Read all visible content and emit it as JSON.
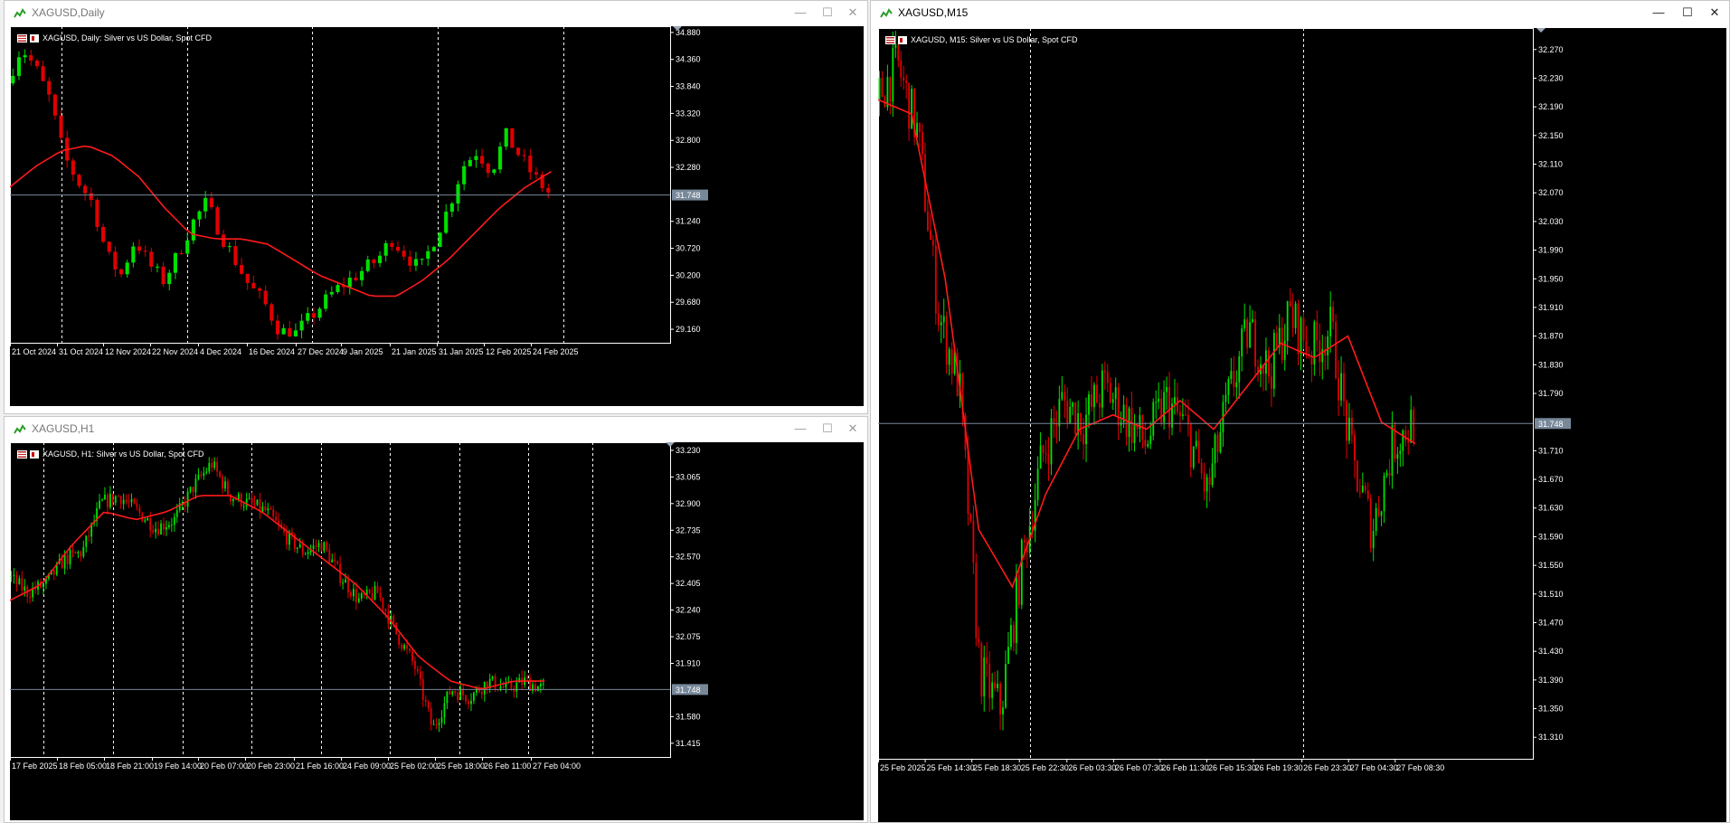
{
  "colors": {
    "bull": "#00e000",
    "bear": "#e00000",
    "ma": "#ff1a1a",
    "price_line": "#778899",
    "grid": "#ffffff"
  },
  "windows": [
    {
      "title": "XAGUSD,Daily",
      "legend": "XAGUSD, Daily:  Silver vs US Dollar, Spot CFD",
      "price_label": "31.748",
      "y_labels": [
        "34.880",
        "34.360",
        "33.840",
        "33.320",
        "32.800",
        "32.280",
        "31.240",
        "30.720",
        "30.200",
        "29.680",
        "29.160"
      ],
      "x_labels": [
        "21 Oct 2024",
        "31 Oct 2024",
        "12 Nov 2024",
        "22 Nov 2024",
        "4 Dec 2024",
        "16 Dec 2024",
        "27 Dec 2024",
        "9 Jan 2025",
        "21 Jan 2025",
        "31 Jan 2025",
        "12 Feb 2025",
        "24 Feb 2025"
      ]
    },
    {
      "title": "XAGUSD,H1",
      "legend": "XAGUSD, H1:  Silver vs US Dollar, Spot CFD",
      "price_label": "31.748",
      "y_labels": [
        "33.230",
        "33.065",
        "32.900",
        "32.735",
        "32.570",
        "32.405",
        "32.240",
        "32.075",
        "31.910",
        "31.580",
        "31.415"
      ],
      "x_labels": [
        "17 Feb 2025",
        "18 Feb 05:00",
        "18 Feb 21:00",
        "19 Feb 14:00",
        "20 Feb 07:00",
        "20 Feb 23:00",
        "21 Feb 16:00",
        "24 Feb 09:00",
        "25 Feb 02:00",
        "25 Feb 18:00",
        "26 Feb 11:00",
        "27 Feb 04:00"
      ]
    },
    {
      "title": "XAGUSD,M15",
      "legend": "XAGUSD, M15:  Silver vs US Dollar, Spot CFD",
      "price_label": "31.748",
      "y_labels": [
        "32.270",
        "32.230",
        "32.190",
        "32.150",
        "32.110",
        "32.070",
        "32.030",
        "31.990",
        "31.950",
        "31.910",
        "31.870",
        "31.830",
        "31.790",
        "31.710",
        "31.670",
        "31.630",
        "31.590",
        "31.550",
        "31.510",
        "31.470",
        "31.430",
        "31.390",
        "31.350",
        "31.310"
      ],
      "x_labels": [
        "25 Feb 2025",
        "25 Feb 14:30",
        "25 Feb 18:30",
        "25 Feb 22:30",
        "26 Feb 03:30",
        "26 Feb 07:30",
        "26 Feb 11:30",
        "26 Feb 15:30",
        "26 Feb 19:30",
        "26 Feb 23:30",
        "27 Feb 04:30",
        "27 Feb 08:30"
      ]
    }
  ],
  "chart_data": [
    {
      "type": "candlestick",
      "symbol": "XAGUSD",
      "timeframe": "Daily",
      "ylim": [
        28.9,
        35.0
      ],
      "current_price": 31.748,
      "x_ticks": [
        "21 Oct 2024",
        "31 Oct 2024",
        "12 Nov 2024",
        "22 Nov 2024",
        "4 Dec 2024",
        "16 Dec 2024",
        "27 Dec 2024",
        "9 Jan 2025",
        "21 Jan 2025",
        "31 Jan 2025",
        "12 Feb 2025",
        "24 Feb 2025"
      ],
      "close_path": [
        33.9,
        34.6,
        34.2,
        33.6,
        32.5,
        32.0,
        31.6,
        30.6,
        30.2,
        30.9,
        30.4,
        30.1,
        30.6,
        31.2,
        31.6,
        31.0,
        30.5,
        30.0,
        29.7,
        29.2,
        29.0,
        29.3,
        29.6,
        29.9,
        30.1,
        30.3,
        30.5,
        30.9,
        30.6,
        30.3,
        30.9,
        31.5,
        32.3,
        32.6,
        32.2,
        32.9,
        32.5,
        32.1,
        31.8
      ],
      "ma_path": [
        31.9,
        32.3,
        32.6,
        32.7,
        32.5,
        32.1,
        31.5,
        31.0,
        30.9,
        30.9,
        30.8,
        30.5,
        30.2,
        30.0,
        29.8,
        29.8,
        30.1,
        30.5,
        31.0,
        31.5,
        31.9,
        32.2
      ]
    },
    {
      "type": "candlestick",
      "symbol": "XAGUSD",
      "timeframe": "H1",
      "ylim": [
        31.33,
        33.28
      ],
      "current_price": 31.748,
      "x_ticks": [
        "17 Feb 2025",
        "18 Feb 05:00",
        "18 Feb 21:00",
        "19 Feb 14:00",
        "20 Feb 07:00",
        "20 Feb 23:00",
        "21 Feb 16:00",
        "24 Feb 09:00",
        "25 Feb 02:00",
        "25 Feb 18:00",
        "26 Feb 11:00",
        "27 Feb 04:00"
      ],
      "close_path": [
        32.45,
        32.35,
        32.4,
        32.55,
        32.6,
        32.9,
        32.95,
        32.85,
        32.75,
        32.8,
        33.0,
        33.15,
        32.95,
        32.9,
        32.85,
        32.7,
        32.6,
        32.65,
        32.45,
        32.3,
        32.35,
        32.1,
        31.9,
        31.5,
        31.75,
        31.7,
        31.8,
        31.75,
        31.8,
        31.75
      ],
      "ma_path": [
        32.3,
        32.4,
        32.65,
        32.85,
        32.8,
        32.85,
        32.95,
        32.95,
        32.85,
        32.7,
        32.55,
        32.4,
        32.2,
        31.95,
        31.8,
        31.75,
        31.8,
        31.8
      ]
    },
    {
      "type": "candlestick",
      "symbol": "XAGUSD",
      "timeframe": "M15",
      "ylim": [
        31.28,
        32.3
      ],
      "current_price": 31.748,
      "x_ticks": [
        "25 Feb 2025",
        "25 Feb 14:30",
        "25 Feb 18:30",
        "25 Feb 22:30",
        "26 Feb 03:30",
        "26 Feb 07:30",
        "26 Feb 11:30",
        "26 Feb 15:30",
        "26 Feb 19:30",
        "26 Feb 23:30",
        "27 Feb 04:30",
        "27 Feb 08:30"
      ],
      "close_path": [
        32.2,
        32.25,
        32.15,
        31.9,
        31.8,
        31.4,
        31.35,
        31.55,
        31.7,
        31.78,
        31.75,
        31.8,
        31.76,
        31.72,
        31.78,
        31.74,
        31.65,
        31.78,
        31.88,
        31.82,
        31.9,
        31.85,
        31.88,
        31.7,
        31.6,
        31.72,
        31.75
      ],
      "ma_path": [
        32.2,
        32.18,
        31.95,
        31.6,
        31.52,
        31.65,
        31.74,
        31.76,
        31.74,
        31.78,
        31.74,
        31.8,
        31.86,
        31.84,
        31.87,
        31.75,
        31.72
      ]
    }
  ]
}
